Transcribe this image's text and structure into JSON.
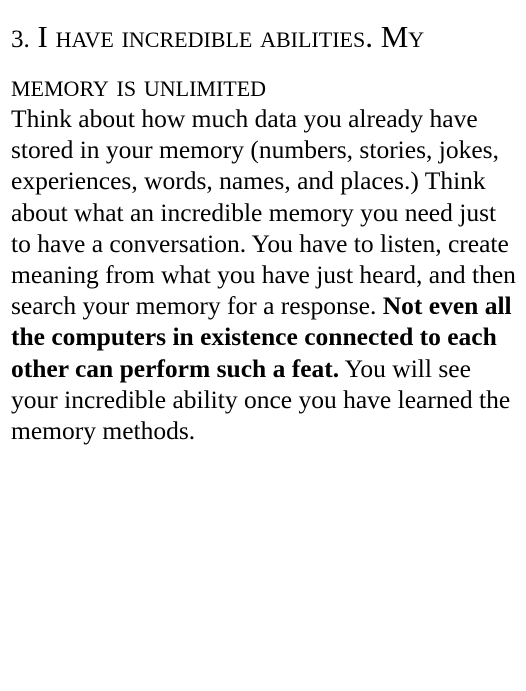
{
  "section": {
    "number": "3.",
    "title": "I have incredible abilities. My memory is unlimited"
  },
  "paragraph": {
    "part1": "Think about how much data you already have stored in your memory (numbers, stories, jokes, experiences, words, names, and places.) Think about what an incredible memory you need just to have a conversation. You have to listen, create meaning from what you have just heard, and then search your memory for a response. ",
    "emphasis": "Not even all the computers in existence connected to each other can perform such a feat.",
    "part2": " You will see your incredible ability once you have learned the memory methods."
  }
}
